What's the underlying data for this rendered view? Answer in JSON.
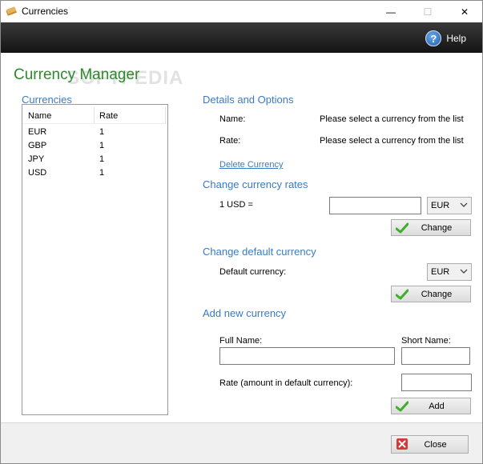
{
  "window": {
    "title": "Currencies",
    "minimize_glyph": "—",
    "maximize_glyph": "☐",
    "close_glyph": "✕"
  },
  "toolbar": {
    "help_label": "Help",
    "help_icon": "?"
  },
  "main": {
    "title": "Currency Manager",
    "watermark": "SOFTPEDIA"
  },
  "currencies": {
    "label": "Currencies",
    "columns": [
      "Name",
      "Rate"
    ],
    "rows": [
      {
        "name": "EUR",
        "rate": "1"
      },
      {
        "name": "GBP",
        "rate": "1"
      },
      {
        "name": "JPY",
        "rate": "1"
      },
      {
        "name": "USD",
        "rate": "1"
      }
    ]
  },
  "details": {
    "label": "Details and Options",
    "name_label": "Name:",
    "name_value": "Please select a currency from the list",
    "rate_label": "Rate:",
    "rate_value": "Please select a currency from the list",
    "delete_link": "Delete Currency"
  },
  "change_rates": {
    "label": "Change currency rates",
    "prefix": "1 USD =",
    "rate_input": "",
    "currency_select": "EUR",
    "button": "Change"
  },
  "default_currency": {
    "label": "Change default currency",
    "field_label": "Default currency:",
    "currency_select": "EUR",
    "button": "Change"
  },
  "add_currency": {
    "label": "Add new currency",
    "full_name_label": "Full Name:",
    "short_name_label": "Short Name:",
    "rate_label": "Rate (amount in default currency):",
    "full_name_value": "",
    "short_name_value": "",
    "rate_value": "",
    "button": "Add"
  },
  "bottom": {
    "close_button": "Close"
  },
  "colors": {
    "title_green": "#2c8a2c",
    "section_blue": "#3a7bbf",
    "toolbar_dark": "#1e1e1e",
    "check_green": "#3fae2a",
    "close_red": "#d23a3a"
  }
}
